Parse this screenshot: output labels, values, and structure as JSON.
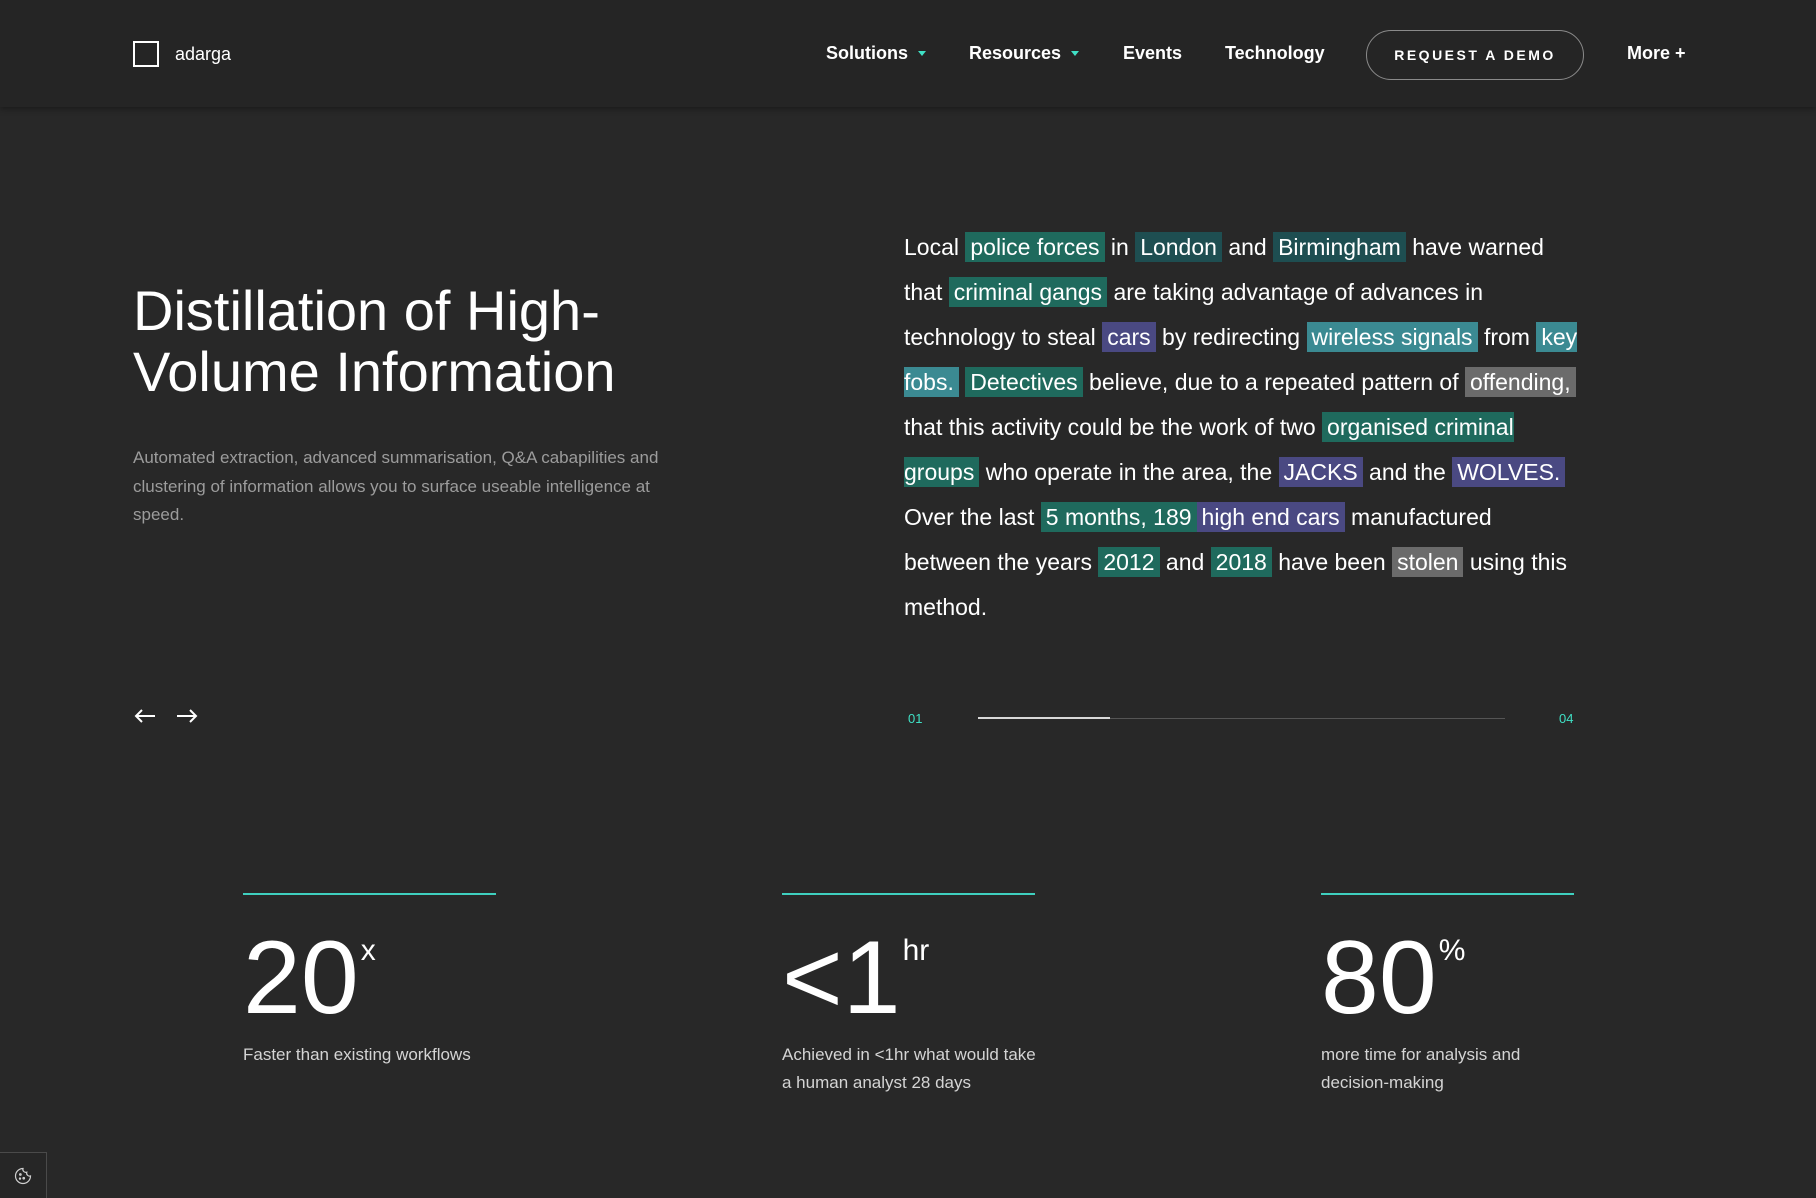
{
  "header": {
    "logo_text": "adarga",
    "nav": {
      "solutions": "Solutions",
      "resources": "Resources",
      "events": "Events",
      "technology": "Technology",
      "demo": "REQUEST A DEMO",
      "more": "More +"
    }
  },
  "hero": {
    "title": "Distillation of High-Volume Information",
    "description": "Automated extraction, advanced summarisation, Q&A cabapilities and clustering of information allows you to surface useable intelligence at speed."
  },
  "passage": {
    "t1": "Local ",
    "e1": "police forces",
    "t2": " in ",
    "e2": "London",
    "t3": " and ",
    "e3": "Birmingham",
    "t4": " have warned that ",
    "e4": "criminal gangs",
    "t5": " are taking advantage of advances in technology to steal ",
    "e5": "cars",
    "t6": " by redirecting ",
    "e6": "wireless signals",
    "t7": " from ",
    "e7": "key fobs.",
    "t8": " ",
    "e8": "Detectives",
    "t9": " believe, due to a repeated pattern of ",
    "e9": "offending,",
    "t10": " that this activity could be the work of two ",
    "e10": "organised criminal groups",
    "t11": " who operate in the area, the ",
    "e11": "JACKS",
    "t12": " and the ",
    "e12": "WOLVES.",
    "t13": " Over the last ",
    "e13": "5 months, 189",
    "e14": "high end cars",
    "t14": " manufactured between the years ",
    "e15": "2012",
    "t15": " and ",
    "e16": "2018",
    "t16": " have been ",
    "e17": "stolen",
    "t17": " using this method."
  },
  "carousel": {
    "current": "01",
    "total": "04",
    "progress": 0.25
  },
  "stats": [
    {
      "value": "20",
      "suffix": "x",
      "description": "Faster than existing workflows"
    },
    {
      "value": "<1",
      "suffix": "hr",
      "description": "Achieved in <1hr what would take a human analyst 28 days"
    },
    {
      "value": "80",
      "suffix": "%",
      "description": "more time for analysis and decision-making"
    }
  ],
  "icons": {
    "logo": "square-logo-icon",
    "dropdown": "caret-down-icon",
    "prev": "arrow-left-icon",
    "next": "arrow-right-icon",
    "cookie": "cookie-icon"
  },
  "colors": {
    "background": "#282828",
    "accent": "#3fe0c5",
    "highlight_green": "#1f6a5d",
    "highlight_blue": "#4a4982",
    "highlight_teal": "#3b8a92",
    "highlight_grey": "#6b6b6b"
  }
}
